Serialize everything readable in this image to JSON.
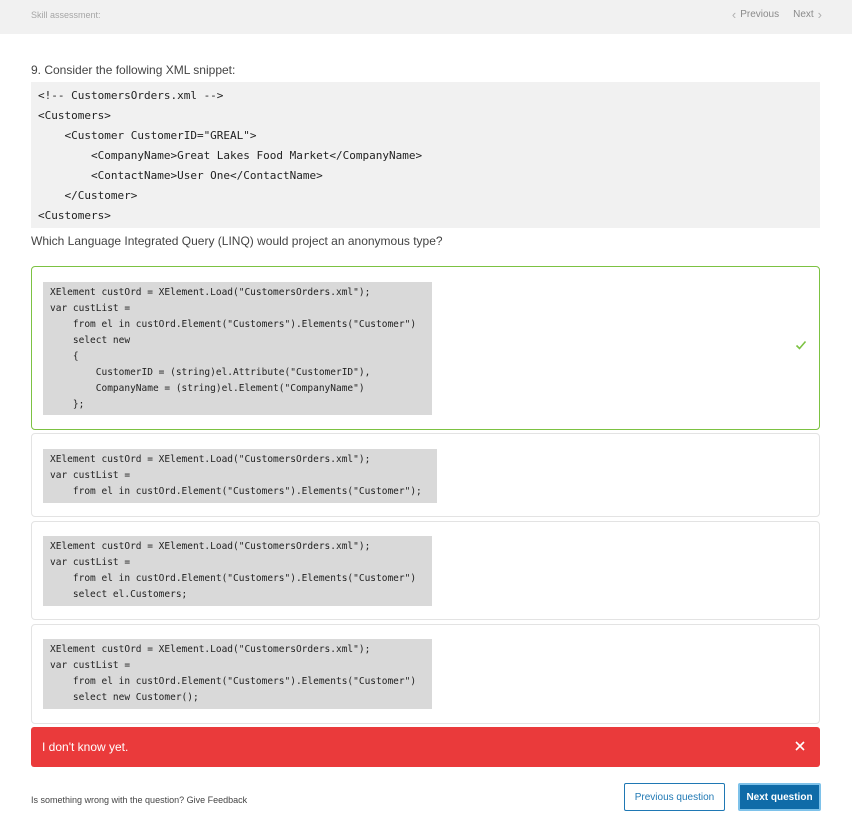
{
  "header": {
    "title": "Skill assessment:",
    "previous_label": "Previous",
    "next_label": "Next"
  },
  "question": {
    "label": "9. Consider the following XML snippet:",
    "xml_lines": [
      "<!-- CustomersOrders.xml -->",
      "<Customers>",
      "    <Customer CustomerID=\"GREAL\">",
      "        <CompanyName>Great Lakes Food Market</CompanyName>",
      "        <ContactName>User One</ContactName>",
      "    </Customer>",
      "<Customers>"
    ],
    "prompt": "Which Language Integrated Query (LINQ) would project an anonymous type?"
  },
  "options": [
    {
      "selected_correct": true,
      "status_icon": "check-icon",
      "lines": [
        "XElement custOrd = XElement.Load(\"CustomersOrders.xml\");",
        "var custList =",
        "    from el in custOrd.Element(\"Customers\").Elements(\"Customer\")",
        "    select new",
        "    {",
        "        CustomerID = (string)el.Attribute(\"CustomerID\"),",
        "        CompanyName = (string)el.Element(\"CompanyName\")",
        "    };"
      ]
    },
    {
      "selected_correct": false,
      "lines": [
        "XElement custOrd = XElement.Load(\"CustomersOrders.xml\");",
        "var custList =",
        "    from el in custOrd.Element(\"Customers\").Elements(\"Customer\");"
      ]
    },
    {
      "selected_correct": false,
      "lines": [
        "XElement custOrd = XElement.Load(\"CustomersOrders.xml\");",
        "var custList =",
        "    from el in custOrd.Element(\"Customers\").Elements(\"Customer\")",
        "    select el.Customers;"
      ]
    },
    {
      "selected_correct": false,
      "lines": [
        "XElement custOrd = XElement.Load(\"CustomersOrders.xml\");",
        "var custList =",
        "    from el in custOrd.Element(\"Customers\").Elements(\"Customer\")",
        "    select new Customer();"
      ]
    }
  ],
  "banner": {
    "text": "I don't know yet.",
    "close_icon": "close-icon",
    "color": "#ea3a3b"
  },
  "footer": {
    "feedback_text": "Is something wrong with the question? Give Feedback",
    "previous_question_label": "Previous question",
    "next_question_label": "Next question"
  },
  "colors": {
    "correct_border": "#7cc242",
    "primary_button": "#0f6ba8"
  }
}
